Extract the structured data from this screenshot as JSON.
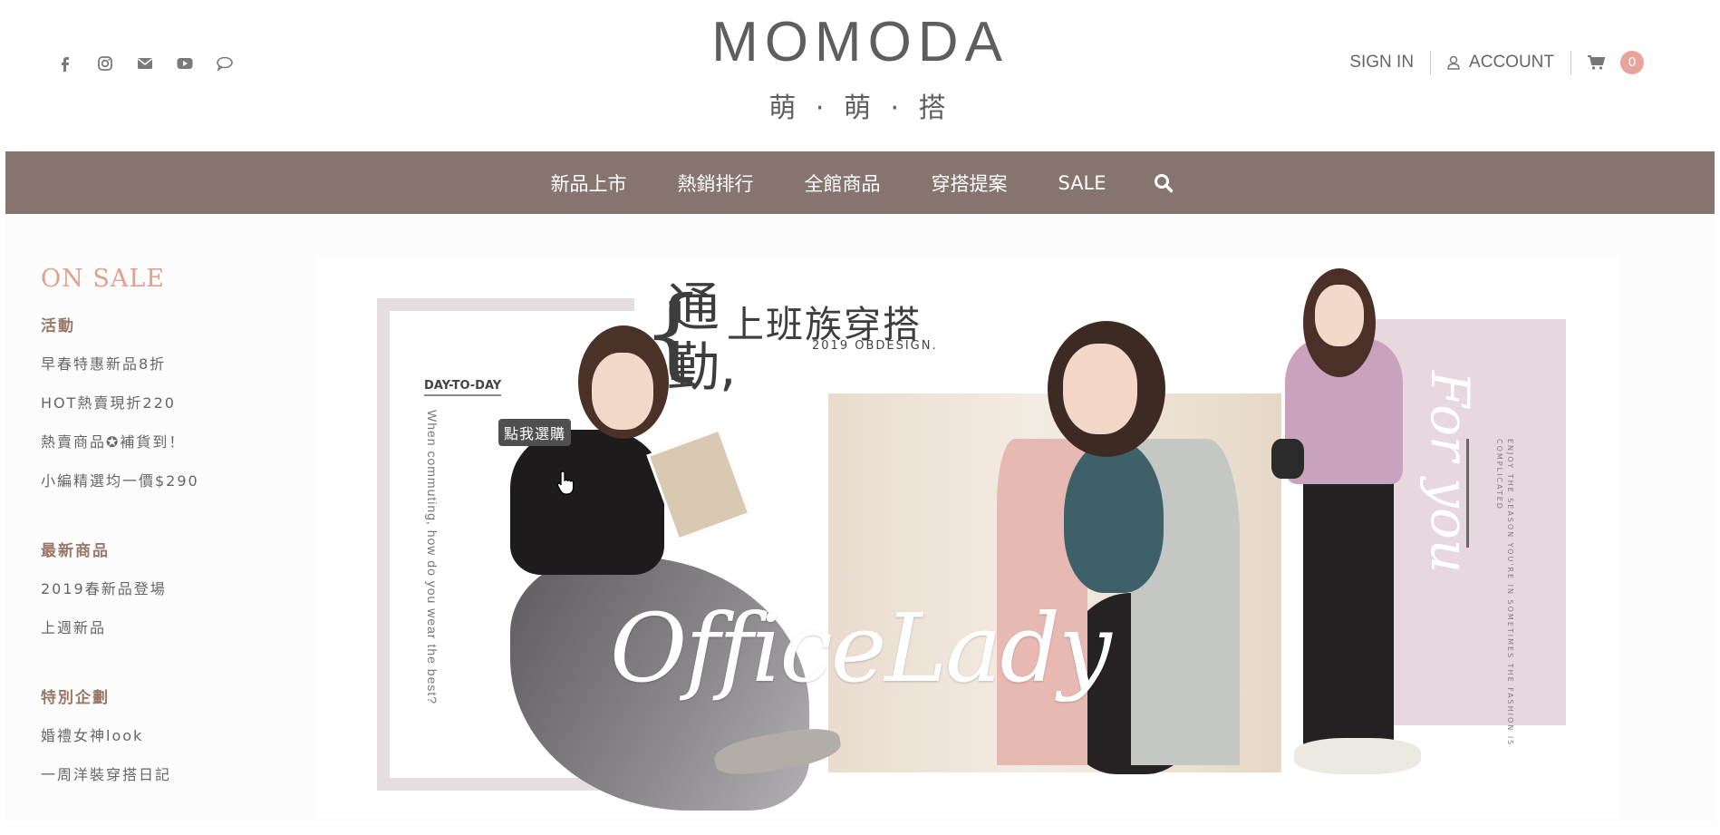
{
  "header": {
    "social_icons": [
      "facebook-icon",
      "instagram-icon",
      "mail-icon",
      "youtube-icon",
      "chat-icon"
    ],
    "logo": {
      "main": "MOMODA",
      "sub": "萌 · 萌 · 搭"
    },
    "account": {
      "sign_in": "SIGN IN",
      "account": "ACCOUNT",
      "cart_count": "0"
    }
  },
  "nav": {
    "items": [
      "新品上市",
      "熱銷排行",
      "全館商品",
      "穿搭提案",
      "SALE"
    ],
    "search_icon": "search-icon"
  },
  "sidebar": {
    "title": "ON SALE",
    "groups": [
      {
        "title": "活動",
        "links": [
          "早春特惠新品8折",
          "HOT熱賣現折220",
          "熱賣商品✪補貨到！",
          "小編精選均一價$290"
        ]
      },
      {
        "title": "最新商品",
        "links": [
          "2019春新品登場",
          "上週新品"
        ]
      },
      {
        "title": "特別企劃",
        "links": [
          "婚禮女神look",
          "一周洋裝穿搭日記"
        ]
      }
    ]
  },
  "banner": {
    "tongqin": "通\n勤,",
    "subtitle": "上班族穿搭",
    "year": "2019 OBDESIGN.",
    "day_to_day": "DAY-TO-DAY",
    "commute": "When commuting, how do you wear the best?",
    "office_lady": "OfficeLady",
    "for_you": "For you",
    "enjoy": "ENJOY THE SEASON YOU'RE IN SOMETIMES THE FASHION IS COMPLICATED",
    "tooltip": "點我選購"
  },
  "colors": {
    "nav_bg": "#85756e",
    "accent": "#e0a08e",
    "badge": "#e8a49a"
  }
}
